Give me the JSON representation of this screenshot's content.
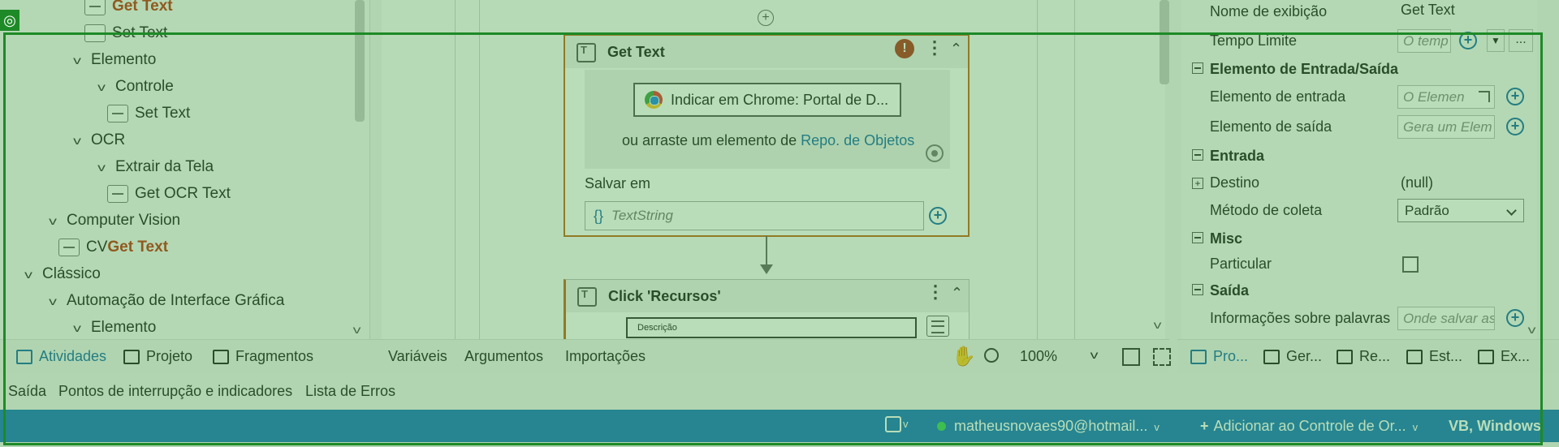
{
  "activities_tree": [
    {
      "label_pre": "",
      "label_hl": "Get Text",
      "indent": 80,
      "chevron": false,
      "icon": true
    },
    {
      "label_pre": "Set Text",
      "label_hl": "",
      "indent": 80,
      "chevron": false,
      "icon": true
    },
    {
      "label_pre": "Elemento",
      "label_hl": "",
      "indent": 60,
      "chevron": true,
      "icon": false
    },
    {
      "label_pre": "Controle",
      "label_hl": "",
      "indent": 90,
      "chevron": true,
      "icon": false
    },
    {
      "label_pre": "Set Text",
      "label_hl": "",
      "indent": 108,
      "chevron": false,
      "icon": true
    },
    {
      "label_pre": "OCR",
      "label_hl": "",
      "indent": 60,
      "chevron": true,
      "icon": false
    },
    {
      "label_pre": "Extrair da Tela",
      "label_hl": "",
      "indent": 90,
      "chevron": true,
      "icon": false
    },
    {
      "label_pre": "Get OCR Text",
      "label_hl": "",
      "indent": 108,
      "chevron": false,
      "icon": true
    },
    {
      "label_pre": "Computer Vision",
      "label_hl": "",
      "indent": 30,
      "chevron": true,
      "icon": false
    },
    {
      "label_pre": "CV ",
      "label_hl": "Get Text",
      "indent": 48,
      "chevron": false,
      "icon": true
    },
    {
      "label_pre": "Clássico",
      "label_hl": "",
      "indent": 0,
      "chevron": true,
      "icon": false
    },
    {
      "label_pre": "Automação de Interface Gráfica",
      "label_hl": "",
      "indent": 30,
      "chevron": true,
      "icon": false
    },
    {
      "label_pre": "Elemento",
      "label_hl": "",
      "indent": 60,
      "chevron": true,
      "icon": false
    }
  ],
  "left_tabs": {
    "atividades": "Atividades",
    "projeto": "Projeto",
    "fragmentos": "Fragmentos"
  },
  "designer": {
    "get_text_card": {
      "title": "Get Text",
      "error": "!",
      "indicate_label": "Indicar em  Chrome: Portal de D...",
      "drag_text": "ou arraste um elemento de ",
      "drag_link": "Repo. de Objetos",
      "save_label": "Salvar em",
      "save_value": "TextString",
      "curly": "{}"
    },
    "click_card": {
      "title": "Click 'Recursos'",
      "dropdown": "Descrição"
    },
    "bottom_tabs": {
      "variaveis": "Variáveis",
      "argumentos": "Argumentos",
      "importacoes": "Importações"
    },
    "zoom": "100%"
  },
  "properties": {
    "nome_label": "Nome de exibição",
    "nome_value": "Get Text",
    "tempo_label": "Tempo Limite",
    "tempo_placeholder": "O temp",
    "ellipsis": "...",
    "sec_entrada_saida": "Elemento de Entrada/Saída",
    "elem_entrada_label": "Elemento de entrada",
    "elem_entrada_placeholder": "O Elemen",
    "elem_saida_label": "Elemento de saída",
    "elem_saida_placeholder": "Gera um Elem",
    "sec_entrada": "Entrada",
    "destino_label": "Destino",
    "destino_value": "(null)",
    "metodo_label": "Método de coleta",
    "metodo_value": "Padrão",
    "sec_misc": "Misc",
    "particular_label": "Particular",
    "sec_saida": "Saída",
    "info_label": "Informações sobre palavras",
    "info_placeholder": "Onde salvar as"
  },
  "right_tabs": {
    "pro": "Pro...",
    "ger": "Ger...",
    "re": "Re...",
    "est": "Est...",
    "ex": "Ex..."
  },
  "output_tabs": {
    "saida": "Saída",
    "pontos": "Pontos de interrupção e indicadores",
    "erros": "Lista de Erros"
  },
  "statusbar": {
    "account": "matheusnovaes90@hotmail...",
    "source_control": "Adicionar ao Controle de Or...",
    "lang": "VB, Windows"
  },
  "colors": {
    "highlight": "#c1310f",
    "status_bar": "#1976bf",
    "overlay": "#1e8a27",
    "link": "#1769aa"
  }
}
